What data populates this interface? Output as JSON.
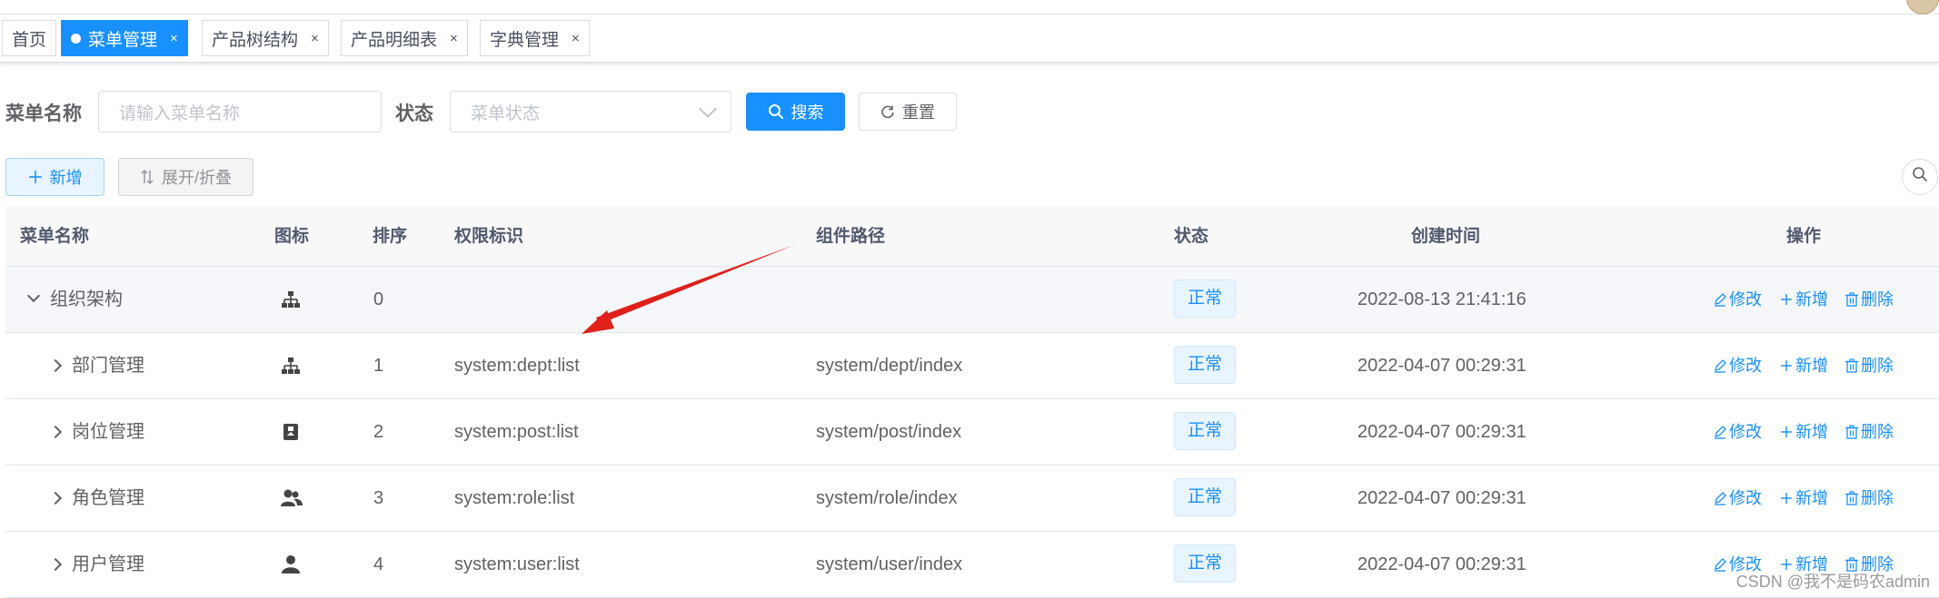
{
  "tags": [
    {
      "label": "首页",
      "active": false,
      "closable": false
    },
    {
      "label": "菜单管理",
      "active": true,
      "closable": true
    },
    {
      "label": "产品树结构",
      "active": false,
      "closable": true
    },
    {
      "label": "产品明细表",
      "active": false,
      "closable": true
    },
    {
      "label": "字典管理",
      "active": false,
      "closable": true
    }
  ],
  "tag_close": "×",
  "search": {
    "menu_name_label": "菜单名称",
    "menu_name_placeholder": "请输入菜单名称",
    "status_label": "状态",
    "status_placeholder": "菜单状态",
    "search_button": "搜索",
    "reset_button": "重置"
  },
  "toolbar": {
    "add_button": "新增",
    "expand_button": "展开/折叠"
  },
  "table": {
    "columns": [
      "菜单名称",
      "图标",
      "排序",
      "权限标识",
      "组件路径",
      "状态",
      "创建时间",
      "操作"
    ],
    "rows": [
      {
        "name": "组织架构",
        "icon": "tree-icon",
        "order": "0",
        "perms": "",
        "component": "",
        "status": "正常",
        "created": "2022-08-13 21:41:16",
        "expanded": true
      },
      {
        "name": "部门管理",
        "icon": "tree-icon",
        "order": "1",
        "perms": "system:dept:list",
        "component": "system/dept/index",
        "status": "正常",
        "created": "2022-04-07 00:29:31",
        "expanded": false
      },
      {
        "name": "岗位管理",
        "icon": "post-icon",
        "order": "2",
        "perms": "system:post:list",
        "component": "system/post/index",
        "status": "正常",
        "created": "2022-04-07 00:29:31",
        "expanded": false
      },
      {
        "name": "角色管理",
        "icon": "peoples-icon",
        "order": "3",
        "perms": "system:role:list",
        "component": "system/role/index",
        "status": "正常",
        "created": "2022-04-07 00:29:31",
        "expanded": false
      },
      {
        "name": "用户管理",
        "icon": "user-icon",
        "order": "4",
        "perms": "system:user:list",
        "component": "system/user/index",
        "status": "正常",
        "created": "2022-04-07 00:29:31",
        "expanded": false
      }
    ],
    "actions": {
      "edit": "修改",
      "add": "新增",
      "delete": "删除"
    }
  },
  "watermark": "CSDN @我不是码农admin",
  "colors": {
    "primary": "#1890ff",
    "arrow": "#e0201b"
  }
}
